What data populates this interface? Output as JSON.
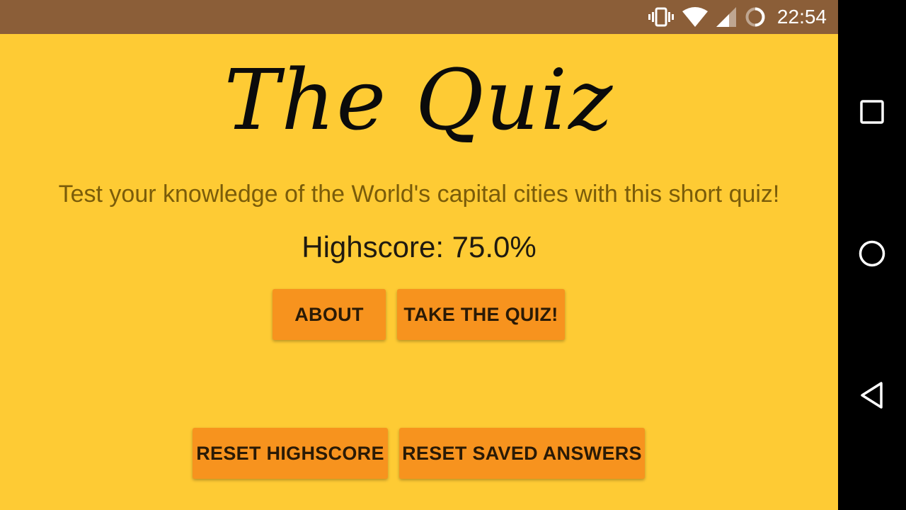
{
  "status_bar": {
    "time": "22:54",
    "icons": [
      "vibrate-icon",
      "wifi-icon",
      "cell-signal-icon",
      "battery-charging-icon"
    ],
    "color": "#8b5e38"
  },
  "app": {
    "title": "The Quiz",
    "subtitle": "Test your knowledge of the World's capital cities with this short quiz!",
    "highscore_text": "Highscore: 75.0%",
    "buttons": {
      "about": "ABOUT",
      "take_quiz": "TAKE THE QUIZ!",
      "reset_highscore": "RESET HIGHSCORE",
      "reset_saved_answers": "RESET SAVED ANSWERS"
    },
    "colors": {
      "background": "#fecb34",
      "button": "#f7931e",
      "subtitle": "#7a5c0a"
    }
  },
  "nav_bar": {
    "items": [
      "recents-icon",
      "home-icon",
      "back-icon"
    ]
  }
}
